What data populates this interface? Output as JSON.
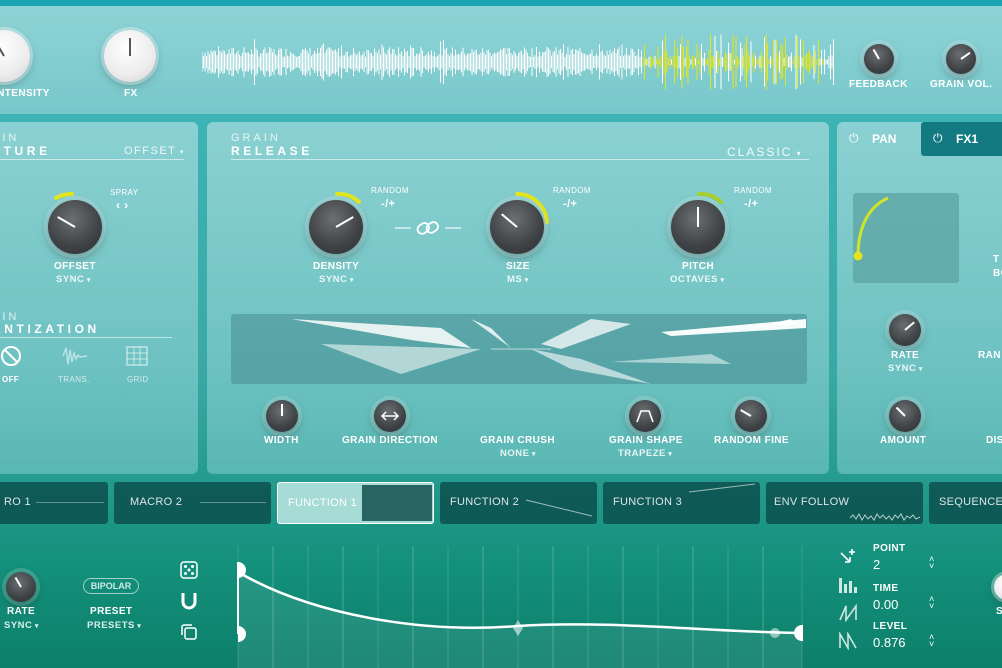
{
  "top": {
    "knob_intensity": "INTENSITY",
    "knob_fx": "FX",
    "knob_feedback": "FEEDBACK",
    "knob_grain_vol": "GRAIN VOL."
  },
  "capture": {
    "title_line1": "AIN",
    "title_line2": "PTURE",
    "mode": "OFFSET",
    "spray": "SPRAY",
    "offset_label": "OFFSET",
    "offset_sub": "SYNC",
    "quant_title1": "AIN",
    "quant_title2": "ANTIZATION",
    "off": "OFF",
    "trans": "TRANS.",
    "grid": "GRID"
  },
  "release": {
    "title_line1": "GRAIN",
    "title_line2": "RELEASE",
    "mode": "CLASSIC",
    "random": "RANDOM",
    "random_val": "-/+",
    "density": "DENSITY",
    "density_sub": "SYNC",
    "size": "SIZE",
    "size_sub": "MS",
    "pitch": "PITCH",
    "pitch_sub": "OCTAVES",
    "width": "WIDTH",
    "grain_direction": "GRAIN DIRECTION",
    "grain_crush": "GRAIN CRUSH",
    "grain_crush_sub": "NONE",
    "grain_shape": "GRAIN SHAPE",
    "grain_shape_sub": "TRAPEZE",
    "random_fine": "RANDOM FINE"
  },
  "right_panel": {
    "tab_pan": "PAN",
    "tab_fx1": "FX1",
    "partial_t": "T",
    "partial_bo": "BO",
    "rate": "RATE",
    "rate_sub": "SYNC",
    "partial_ran": "RAN",
    "amount": "AMOUNT",
    "partial_dis": "DIS"
  },
  "mod_tabs": [
    {
      "label": "RO 1"
    },
    {
      "label": "MACRO 2"
    },
    {
      "label": "FUNCTION 1"
    },
    {
      "label": "FUNCTION 2"
    },
    {
      "label": "FUNCTION 3"
    },
    {
      "label": "ENV FOLLOW"
    },
    {
      "label": "SEQUENCER"
    }
  ],
  "function_editor": {
    "rate": "RATE",
    "rate_sub": "SYNC",
    "bipolar": "BIPOLAR",
    "preset": "PRESET",
    "preset_sub": "PRESETS",
    "point_label": "POINT",
    "point_value": "2",
    "time_label": "TIME",
    "time_value": "0.00",
    "level_label": "LEVEL",
    "level_value": "0.876",
    "partial_s": "S"
  },
  "colors": {
    "accent_yellow": "#e3e61c",
    "accent_green": "#a7cf2e",
    "knob_dark": "#3e4244",
    "panel": "#8ed3d6"
  }
}
